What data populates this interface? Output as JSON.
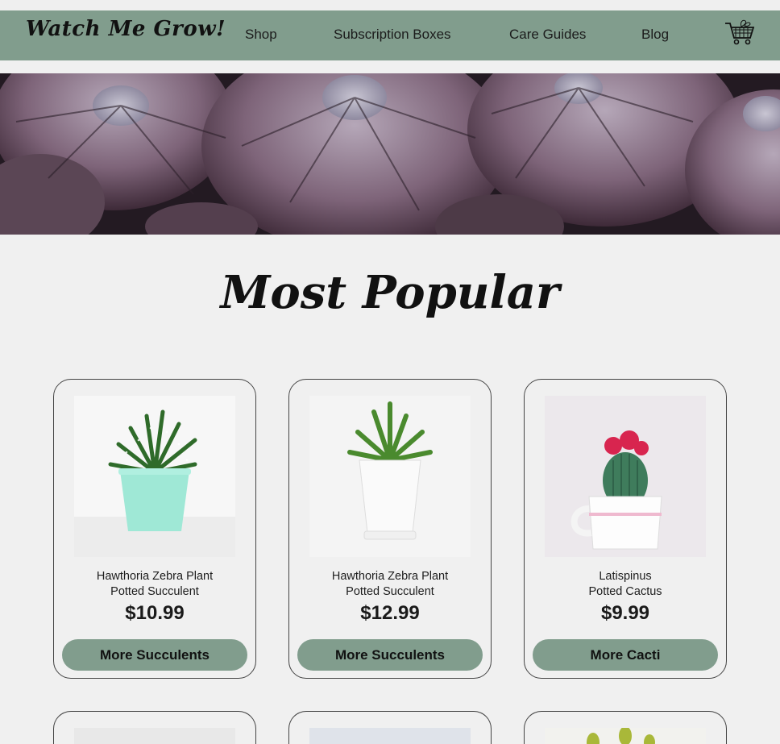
{
  "header": {
    "logo": "Watch Me Grow!",
    "nav": [
      "Shop",
      "Subscription Boxes",
      "Care Guides",
      "Blog"
    ],
    "cart_icon": "shopping-cart-icon"
  },
  "hero": {
    "image": "purple-succulents-banner"
  },
  "section": {
    "title": "Most Popular"
  },
  "products": [
    {
      "name_line1": "Hawthoria Zebra Plant",
      "name_line2": "Potted Succulent",
      "price": "$10.99",
      "button": "More Succulents"
    },
    {
      "name_line1": "Hawthoria Zebra Plant",
      "name_line2": "Potted Succulent",
      "price": "$12.99",
      "button": "More Succulents"
    },
    {
      "name_line1": "Latispinus",
      "name_line2": "Potted Cactus",
      "price": "$9.99",
      "button": "More Cacti"
    }
  ],
  "colors": {
    "accent": "#819d8d",
    "background": "#f0f0f0",
    "text": "#111111"
  }
}
